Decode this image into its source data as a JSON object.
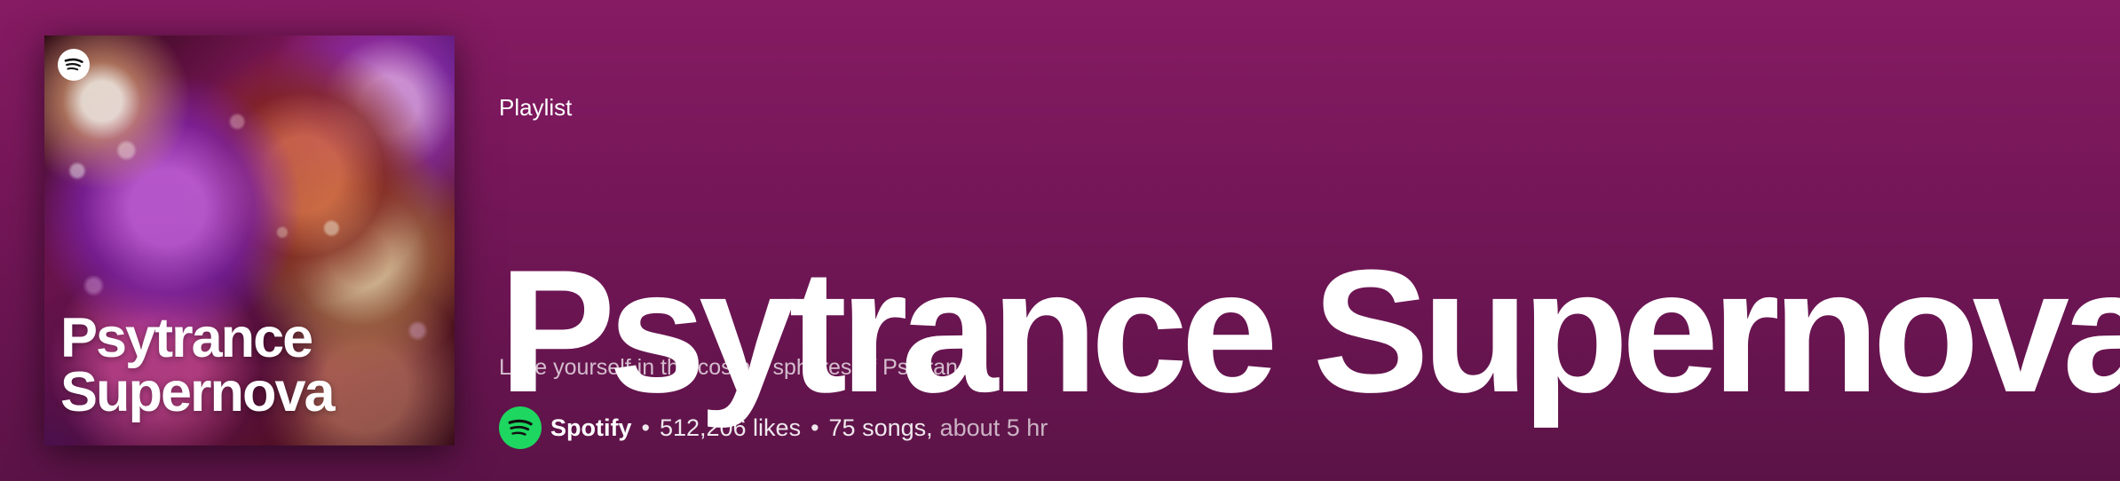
{
  "cover": {
    "title_lines": [
      "Psytrance",
      "Supernova"
    ],
    "logo_icon": "spotify-icon"
  },
  "header": {
    "type_label": "Playlist",
    "title": "Psytrance Supernova",
    "description": "Lose yourself in the cosmic spheres of Psytrance."
  },
  "meta": {
    "owner": "Spotify",
    "likes": "512,206 likes",
    "song_count": "75 songs,",
    "duration": "about 5 hr",
    "separator": "•"
  },
  "colors": {
    "background_top": "#861b63",
    "background_bottom": "#5b1347",
    "spotify_green": "#1ed760",
    "text": "#ffffff"
  }
}
